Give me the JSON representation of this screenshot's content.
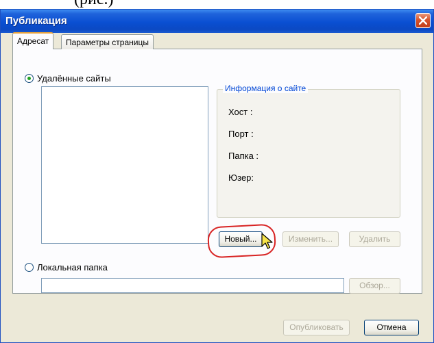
{
  "window": {
    "title": "Публикация",
    "close_icon": "close-icon"
  },
  "tabs": [
    {
      "label": "Адресат",
      "active": true
    },
    {
      "label": "Параметры страницы",
      "active": false
    }
  ],
  "remote_sites": {
    "radio_label": "Удалённые сайты",
    "selected": true
  },
  "site_info": {
    "legend": "Информация о сайте",
    "host_label": "Хост :",
    "port_label": "Порт :",
    "folder_label": "Папка :",
    "user_label": "Юзер:"
  },
  "site_buttons": {
    "new_label": "Новый...",
    "edit_label": "Изменить...",
    "delete_label": "Удалить"
  },
  "local_folder": {
    "radio_label": "Локальная папка",
    "selected": false,
    "path_value": "",
    "browse_label": "Обзор..."
  },
  "footer": {
    "publish_label": "Опубликовать",
    "cancel_label": "Отмена"
  },
  "colors": {
    "titlebar": "#0a4fd2",
    "highlight_circle": "#d82323",
    "active_tab_accent": "#e8a33c",
    "info_legend": "#0046d5"
  }
}
